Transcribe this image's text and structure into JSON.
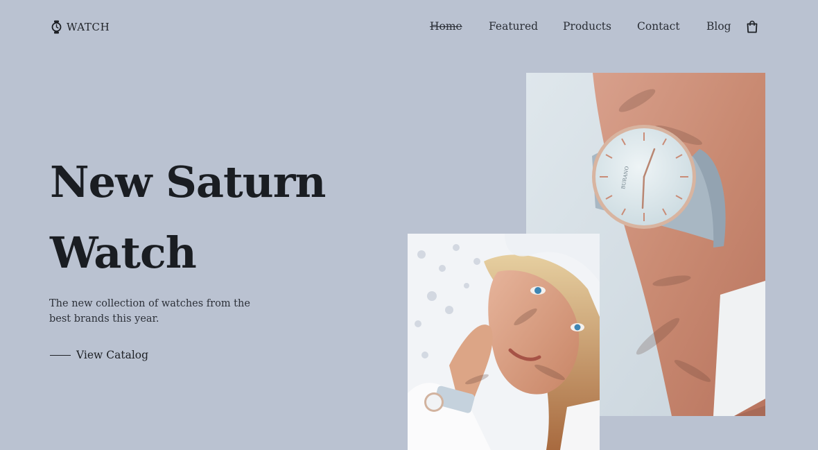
{
  "brand": {
    "name": "WATCH",
    "icon": "watch-icon"
  },
  "nav": {
    "items": [
      {
        "label": "Home",
        "active": true
      },
      {
        "label": "Featured",
        "active": false
      },
      {
        "label": "Products",
        "active": false
      },
      {
        "label": "Contact",
        "active": false
      },
      {
        "label": "Blog",
        "active": false
      }
    ],
    "cart_icon": "shopping-bag-icon"
  },
  "hero": {
    "title_line1": "New Saturn",
    "title_line2": "Watch",
    "description": "The new collection of watches from the best brands this year.",
    "cta_label": "View Catalog"
  },
  "images": {
    "wrist_photo": "wrist-watch-photo",
    "portrait_photo": "woman-portrait-photo",
    "watch_dial_brand": "BURANO"
  },
  "colors": {
    "background": "#bac2d1",
    "text": "#1d2025"
  }
}
